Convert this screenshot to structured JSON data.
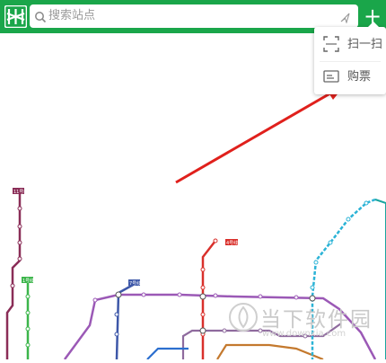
{
  "app": {
    "logo_icon": "shenzhen-metro-logo-icon",
    "accent_color": "#1aa64a"
  },
  "search": {
    "placeholder": "搜索站点",
    "search_icon": "search-icon",
    "location_icon": "location-arrow-icon"
  },
  "header": {
    "plus_label": "+"
  },
  "menu": {
    "items": [
      {
        "label": "扫一扫",
        "icon": "scan-icon"
      },
      {
        "label": "购票",
        "icon": "ticket-icon"
      }
    ]
  },
  "annotation": {
    "arrow_color": "#e0201c"
  },
  "map": {
    "line_labels": [
      "11号线",
      "1号线",
      "7号线",
      "4号线"
    ],
    "line_colors": {
      "line11": "#8a2d57",
      "line1": "#3bb54a",
      "line3": "#2c6fcf",
      "line2": "#c4792e",
      "line4": "#d9302b",
      "line5": "#9b59b6",
      "line6": "#2bb3d6",
      "line7": "#3d57a8",
      "line9": "#8f6b9e"
    }
  },
  "watermark": {
    "text": "当下软件园",
    "subtext": "www.downxia.com"
  }
}
